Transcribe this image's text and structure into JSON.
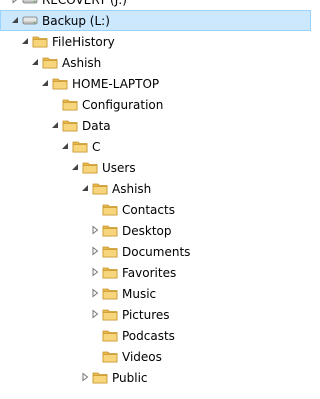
{
  "tree": [
    {
      "label": "RECOVERY (J:)",
      "icon": "drive-icon",
      "expander": "collapsed"
    },
    {
      "label": "Backup (L:)",
      "icon": "drive-icon",
      "expander": "expanded",
      "selected": true
    },
    {
      "label": "FileHistory",
      "icon": "folder-icon",
      "expander": "expanded"
    },
    {
      "label": "Ashish",
      "icon": "folder-icon",
      "expander": "expanded"
    },
    {
      "label": "HOME-LAPTOP",
      "icon": "folder-icon",
      "expander": "expanded"
    },
    {
      "label": "Configuration",
      "icon": "folder-icon",
      "expander": "none"
    },
    {
      "label": "Data",
      "icon": "folder-icon",
      "expander": "expanded"
    },
    {
      "label": "C",
      "icon": "folder-icon",
      "expander": "expanded"
    },
    {
      "label": "Users",
      "icon": "folder-icon",
      "expander": "expanded"
    },
    {
      "label": "Ashish",
      "icon": "folder-icon",
      "expander": "expanded"
    },
    {
      "label": "Contacts",
      "icon": "folder-icon",
      "expander": "none"
    },
    {
      "label": "Desktop",
      "icon": "folder-icon",
      "expander": "collapsed"
    },
    {
      "label": "Documents",
      "icon": "folder-icon",
      "expander": "collapsed"
    },
    {
      "label": "Favorites",
      "icon": "folder-icon",
      "expander": "collapsed"
    },
    {
      "label": "Music",
      "icon": "folder-icon",
      "expander": "collapsed"
    },
    {
      "label": "Pictures",
      "icon": "folder-icon",
      "expander": "collapsed"
    },
    {
      "label": "Podcasts",
      "icon": "folder-icon",
      "expander": "none"
    },
    {
      "label": "Videos",
      "icon": "folder-icon",
      "expander": "none"
    },
    {
      "label": "Public",
      "icon": "folder-icon",
      "expander": "collapsed"
    }
  ],
  "colors": {
    "selection": "#cce8ff",
    "selection_border": "#99d1ff",
    "arrow": "#555555",
    "folder": "#f2c65e"
  }
}
